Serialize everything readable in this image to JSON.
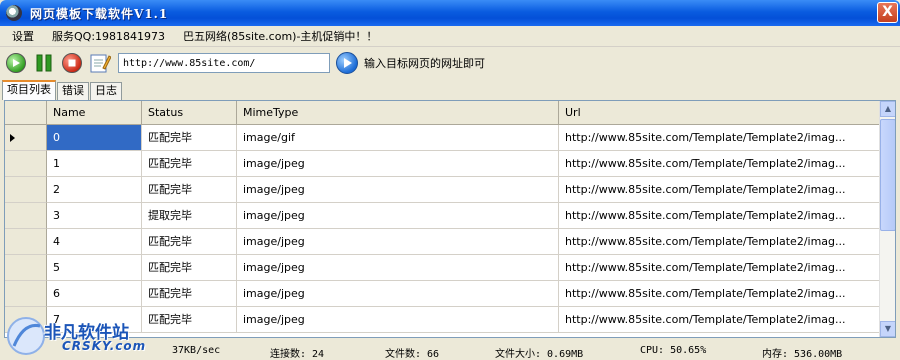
{
  "window": {
    "title": "网页模板下载软件V1.1",
    "close_label": "X"
  },
  "menu": {
    "items": [
      "设置",
      "服务QQ:1981841973",
      "巴五网络(85site.com)-主机促销中！！"
    ]
  },
  "toolbar": {
    "url_value": "http://www.85site.com/",
    "hint": "输入目标网页的网址即可"
  },
  "tabs": [
    "项目列表",
    "错误",
    "日志"
  ],
  "grid": {
    "columns": [
      "Name",
      "Status",
      "MimeType",
      "Url"
    ],
    "rows": [
      [
        "0",
        "匹配完毕",
        "image/gif",
        "http://www.85site.com/Template/Template2/imag..."
      ],
      [
        "1",
        "匹配完毕",
        "image/jpeg",
        "http://www.85site.com/Template/Template2/imag..."
      ],
      [
        "2",
        "匹配完毕",
        "image/jpeg",
        "http://www.85site.com/Template/Template2/imag..."
      ],
      [
        "3",
        "提取完毕",
        "image/jpeg",
        "http://www.85site.com/Template/Template2/imag..."
      ],
      [
        "4",
        "匹配完毕",
        "image/jpeg",
        "http://www.85site.com/Template/Template2/imag..."
      ],
      [
        "5",
        "匹配完毕",
        "image/jpeg",
        "http://www.85site.com/Template/Template2/imag..."
      ],
      [
        "6",
        "匹配完毕",
        "image/jpeg",
        "http://www.85site.com/Template/Template2/imag..."
      ],
      [
        "7",
        "匹配完毕",
        "image/jpeg",
        "http://www.85site.com/Template/Template2/imag..."
      ]
    ]
  },
  "status": {
    "speed": "37KB/sec",
    "connections": "连接数: 24",
    "files": "文件数: 66",
    "size": "文件大小: 0.69MB",
    "cpu": "CPU: 50.65%",
    "memory": "内存: 536.00MB"
  },
  "watermark": {
    "line1": "非凡软件站",
    "line2": "CRSKY.com"
  }
}
